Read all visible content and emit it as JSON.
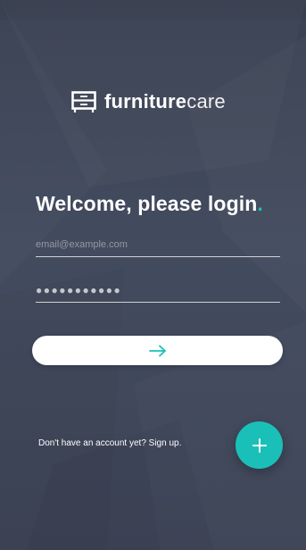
{
  "brand": {
    "name_bold": "furniture",
    "name_light": "care",
    "logo_icon": "dresser-icon"
  },
  "login": {
    "heading": "Welcome, please login",
    "heading_dot": ".",
    "email_placeholder": "email@example.com",
    "email_value": "",
    "password_value": "●●●●●●●●●●●",
    "submit_icon": "arrow-right-icon"
  },
  "footer": {
    "signup_text": "Don't have an account yet? Sign up.",
    "fab_icon": "plus-icon"
  },
  "colors": {
    "background": "#3f4658",
    "accent": "#19c1b6",
    "text": "#ffffff",
    "button": "#ffffff"
  }
}
